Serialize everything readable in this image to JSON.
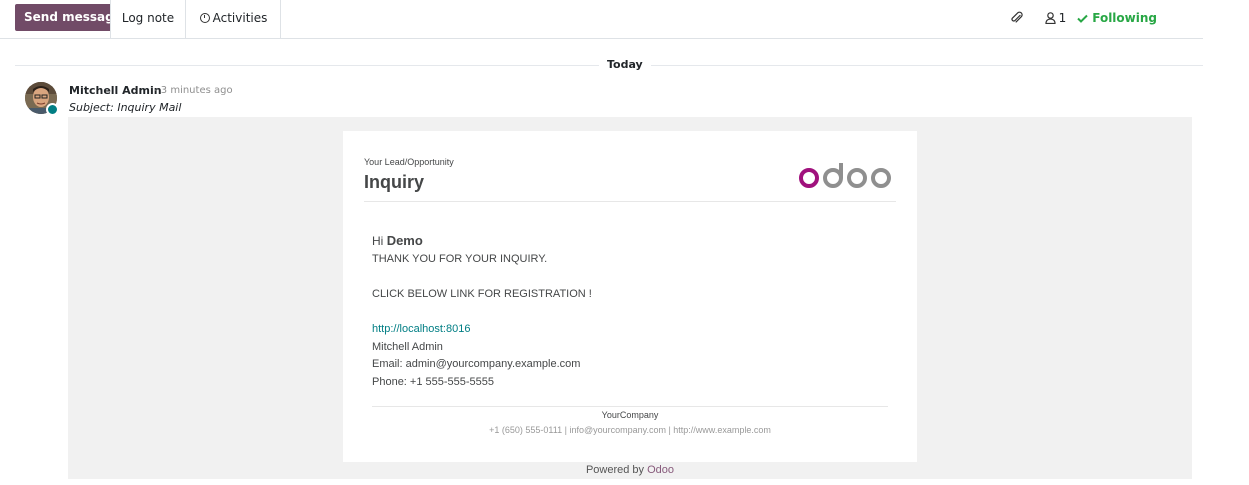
{
  "toolbar": {
    "send_label": "Send message",
    "log_label": "Log note",
    "activities_label": "Activities",
    "follower_count": "1",
    "following_label": "Following"
  },
  "thread": {
    "date_label": "Today",
    "author": "Mitchell Admin",
    "time": "- 3 minutes ago",
    "subject": "Subject: Inquiry Mail",
    "status_color": "#017e84"
  },
  "email": {
    "eyebrow": "Your Lead/Opportunity",
    "headline": "Inquiry",
    "greeting_prefix": "Hi",
    "greeting_name": "Demo",
    "line1": "THANK YOU FOR YOUR INQUIRY.",
    "line2": "CLICK BELOW LINK FOR REGISTRATION !",
    "link": "http://localhost:8016",
    "sign_name": "Mitchell Admin",
    "sign_email": "Email: admin@yourcompany.example.com",
    "sign_phone": "Phone: +1 555-555-5555",
    "company": "YourCompany",
    "contact": "+1 (650) 555-0111 | info@yourcompany.com | http://www.example.com",
    "logo_text": "odoo"
  },
  "footer": {
    "powered_prefix": "Powered by",
    "powered_brand": "Odoo"
  },
  "colors": {
    "send_button": "#714b67",
    "following": "#28a745",
    "link": "#017e84",
    "logo_o": "#a0117d",
    "logo_doo": "#8f8f8f"
  }
}
